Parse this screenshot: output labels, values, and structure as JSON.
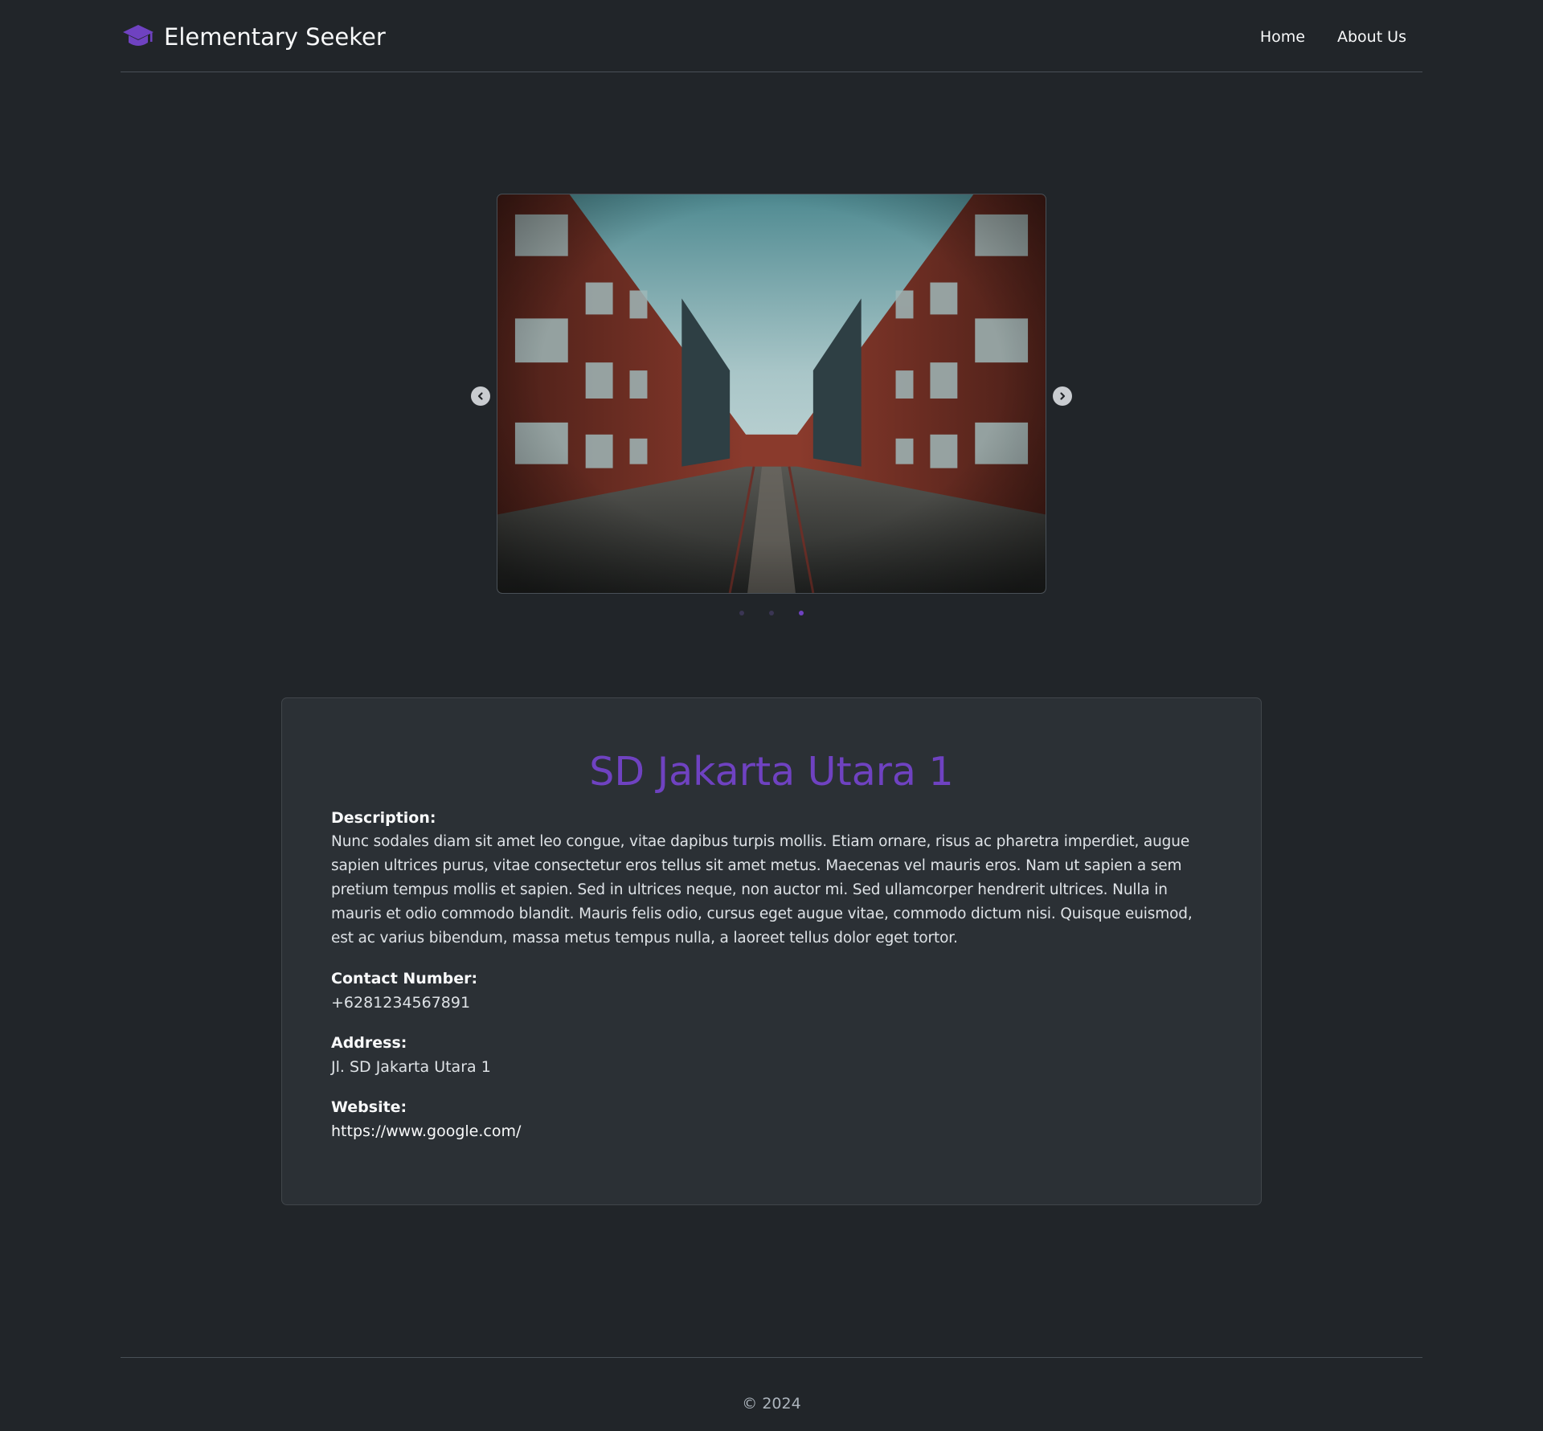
{
  "header": {
    "brand_name": "Elementary Seeker",
    "brand_icon": "graduation-cap-icon",
    "nav": [
      {
        "label": "Home"
      },
      {
        "label": "About Us"
      }
    ]
  },
  "carousel": {
    "slide_count": 3,
    "active_index": 2,
    "prev_icon": "chevron-left-icon",
    "next_icon": "chevron-right-icon"
  },
  "school": {
    "name": "SD Jakarta Utara 1",
    "description_label": "Description:",
    "description": "Nunc sodales diam sit amet leo congue, vitae dapibus turpis mollis. Etiam ornare, risus ac pharetra imperdiet, augue sapien ultrices purus, vitae consectetur eros tellus sit amet metus. Maecenas vel mauris eros. Nam ut sapien a sem pretium tempus mollis et sapien. Sed in ultrices neque, non auctor mi. Sed ullamcorper hendrerit ultrices. Nulla in mauris et odio commodo blandit. Mauris felis odio, cursus eget augue vitae, commodo dictum nisi. Quisque euismod, est ac varius bibendum, massa metus tempus nulla, a laoreet tellus dolor eget tortor.",
    "contact_label": "Contact Number:",
    "contact": "+6281234567891",
    "address_label": "Address:",
    "address": "Jl. SD Jakarta Utara 1",
    "website_label": "Website:",
    "website": "https://www.google.com/"
  },
  "footer": {
    "copyright": "© 2024"
  },
  "colors": {
    "background": "#212529",
    "card": "#2b3035",
    "accent": "#6f42c1"
  }
}
